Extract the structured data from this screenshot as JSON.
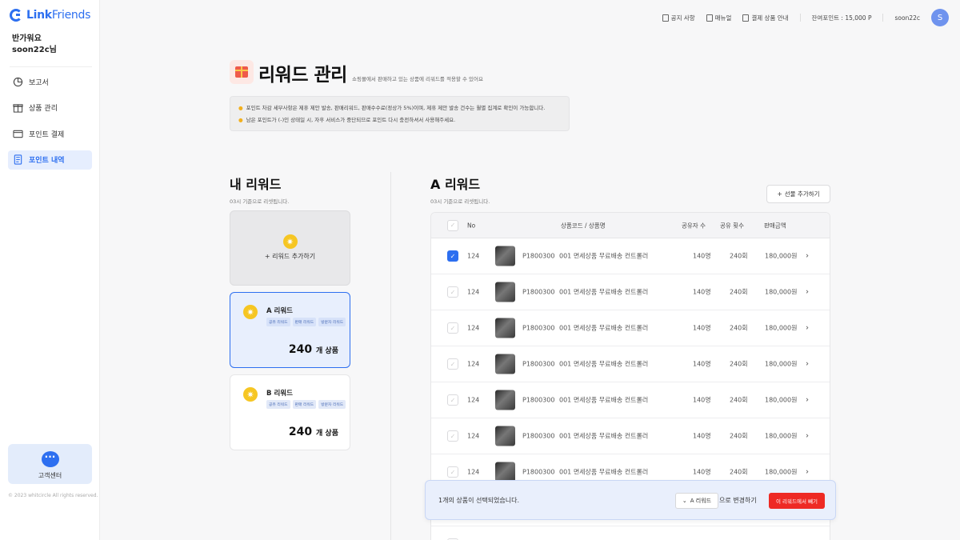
{
  "app": {
    "logo_brand": "Link",
    "logo_suffix": "Friends"
  },
  "sidebar": {
    "greeting_line1": "반가워요",
    "greeting_line2": "soon22c님",
    "items": [
      {
        "label": "보고서",
        "icon": "report-icon"
      },
      {
        "label": "상품 관리",
        "icon": "gift-box-icon"
      },
      {
        "label": "포인트 결제",
        "icon": "point-payment-icon"
      },
      {
        "label": "포인트 내역",
        "icon": "receipt-icon",
        "active": true
      }
    ],
    "support_label": "고객센터",
    "copyright": "© 2023 whitcircle All rights reserved."
  },
  "header": {
    "notice_label": "공지 사항",
    "manual_label": "매뉴얼",
    "payment_guide_label": "결제 상품 안내",
    "points_label": "잔여포인트 : 15,000 P",
    "username": "soon22c",
    "avatar_initial": "S"
  },
  "page": {
    "title": "리워드 관리",
    "subtitle": "쇼핑몰에서 판매하고 있는 상품에 리워드를 적용할 수 있어요",
    "notice_line1": "포인트 차감 세부사항은 제휴 제안 발송, 판매리워드, 판매수수료(정상가 5%)이며, 제휴 제안 발송 건수는 월별 집계로 확인이 가능합니다.",
    "notice_line2": "남은 포인트가 (-)인 상태일 시, 자후 서비스가 중단되므로 포인트 다시 충전하셔서 사용해주세요."
  },
  "my_rewards": {
    "title": "내 리워드",
    "subtitle": "03시 기준으로 리셋됩니다.",
    "add_label": "+ 리워드 추가하기",
    "cards": [
      {
        "name": "A 리워드",
        "tags": [
          "공유 리워드",
          "판매 리워드",
          "방문자 리워드"
        ],
        "count": "240",
        "unit": "개 상품"
      },
      {
        "name": "B 리워드",
        "tags": [
          "공유 리워드",
          "판매 리워드",
          "방문자 리워드"
        ],
        "count": "240",
        "unit": "개 상품"
      }
    ]
  },
  "reward_detail": {
    "title": "A 리워드",
    "subtitle": "03시 기준으로 리셋됩니다.",
    "add_gift_label": "선물 추가하기",
    "columns": {
      "no": "No",
      "product": "상품코드 / 상품명",
      "sharers": "공유자 수",
      "shares": "공유 횟수",
      "sales": "판매금액"
    },
    "rows": [
      {
        "checked": true,
        "no": "124",
        "code": "P1800300",
        "name": "001 면세상품 무료배송 컨트롤러",
        "sharers": "140명",
        "shares": "240회",
        "sales": "180,000원"
      },
      {
        "checked": false,
        "no": "124",
        "code": "P1800300",
        "name": "001 면세상품 무료배송 컨트롤러",
        "sharers": "140명",
        "shares": "240회",
        "sales": "180,000원"
      },
      {
        "checked": false,
        "no": "124",
        "code": "P1800300",
        "name": "001 면세상품 무료배송 컨트롤러",
        "sharers": "140명",
        "shares": "240회",
        "sales": "180,000원"
      },
      {
        "checked": false,
        "no": "124",
        "code": "P1800300",
        "name": "001 면세상품 무료배송 컨트롤러",
        "sharers": "140명",
        "shares": "240회",
        "sales": "180,000원"
      },
      {
        "checked": false,
        "no": "124",
        "code": "P1800300",
        "name": "001 면세상품 무료배송 컨트롤러",
        "sharers": "140명",
        "shares": "240회",
        "sales": "180,000원"
      },
      {
        "checked": false,
        "no": "124",
        "code": "P1800300",
        "name": "001 면세상품 무료배송 컨트롤러",
        "sharers": "140명",
        "shares": "240회",
        "sales": "180,000원"
      },
      {
        "checked": false,
        "no": "124",
        "code": "P1800300",
        "name": "001 면세상품 무료배송 컨트롤러",
        "sharers": "140명",
        "shares": "240회",
        "sales": "180,000원"
      },
      {
        "checked": false,
        "no": "",
        "code": "",
        "name": "",
        "sharers": "",
        "shares": "",
        "sales": ""
      },
      {
        "checked": false,
        "no": "",
        "code": "",
        "name": "",
        "sharers": "",
        "shares": "",
        "sales": ""
      }
    ]
  },
  "action_bar": {
    "selected_text": "1개의 상품이 선택되었습니다.",
    "target_reward": "A 리워드",
    "change_label": "으로 변경하기",
    "remove_label": "이 리워드에서 빼기"
  },
  "colors": {
    "accent": "#2d6ff0",
    "danger": "#ee2a24",
    "reward_sun": "#f6c623"
  }
}
